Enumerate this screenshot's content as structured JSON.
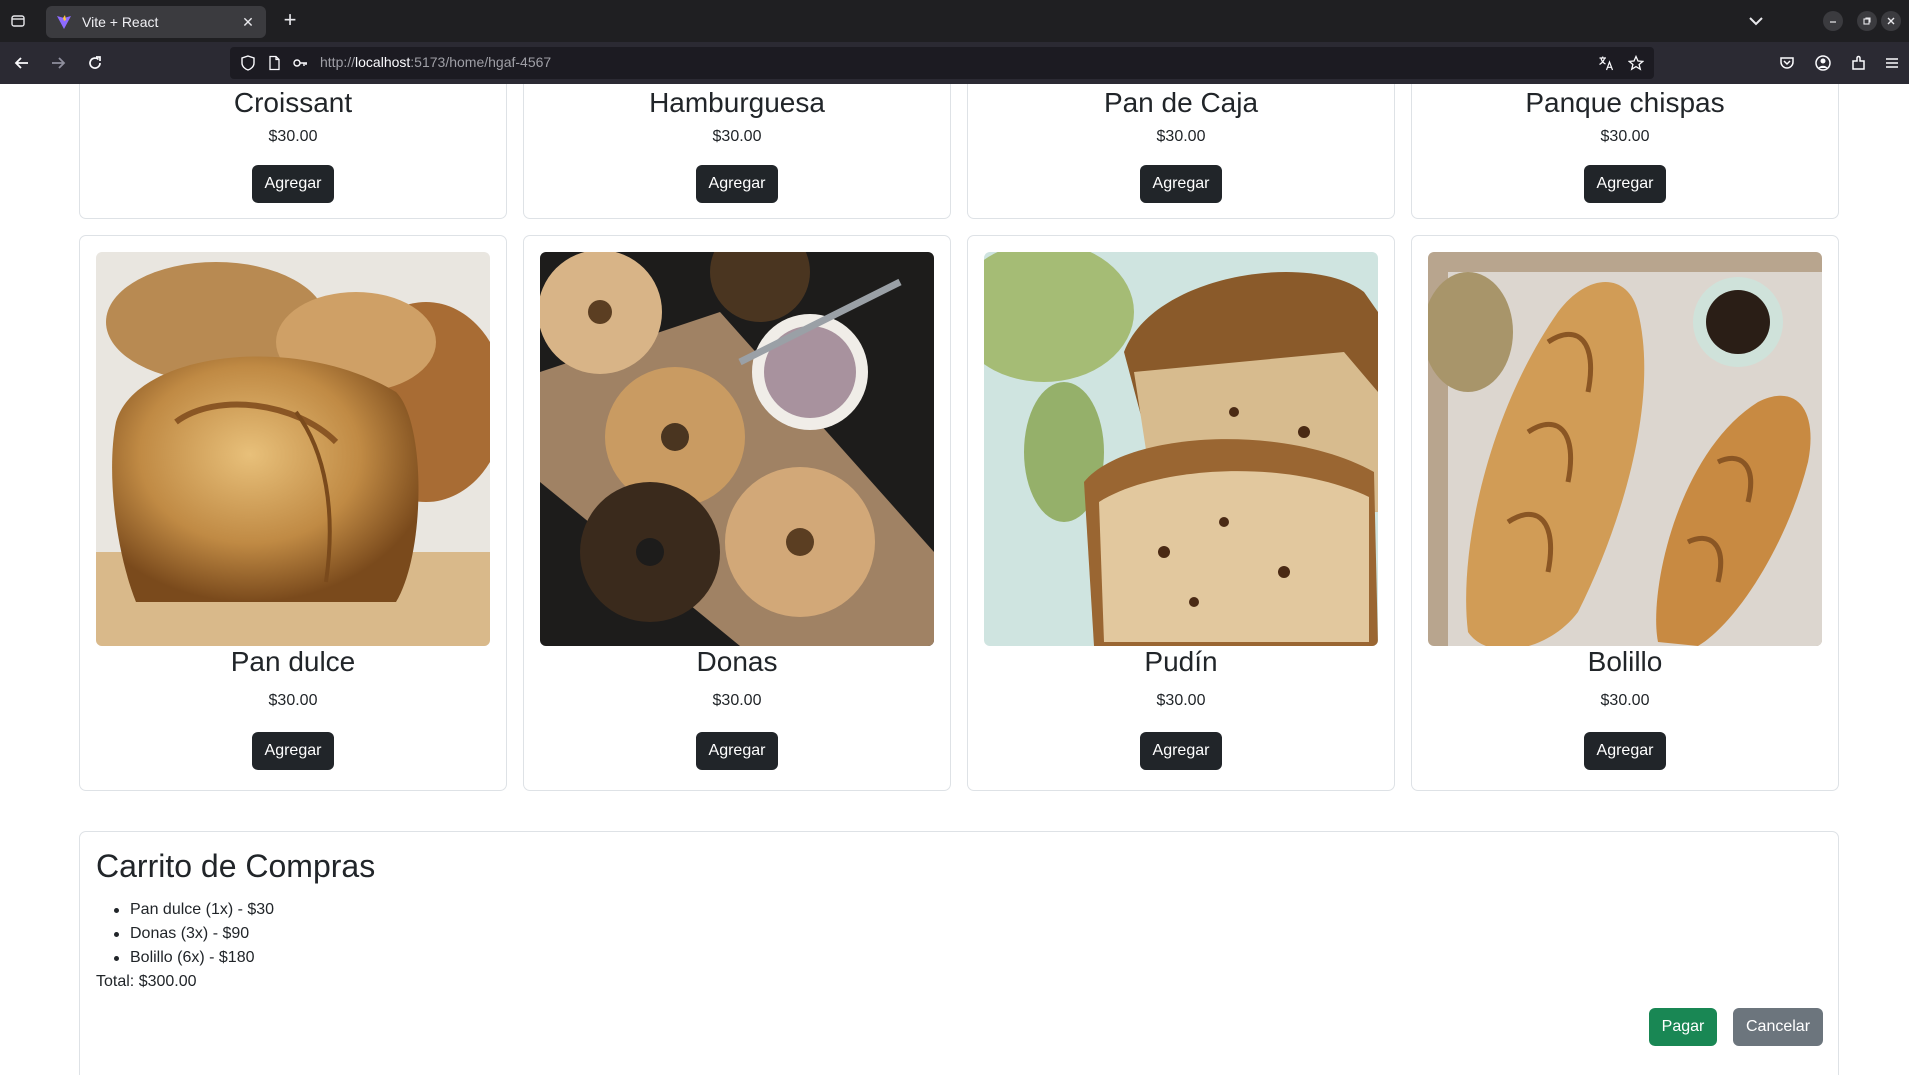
{
  "browser": {
    "tab_title": "Vite + React",
    "close_glyph": "✕",
    "newtab_glyph": "+",
    "url_scheme": "http://",
    "url_host": "localhost",
    "url_path": ":5173/home/hgaf-4567"
  },
  "products_top": [
    {
      "name": "Croissant",
      "price": "$30.00",
      "button": "Agregar"
    },
    {
      "name": "Hamburguesa",
      "price": "$30.00",
      "button": "Agregar"
    },
    {
      "name": "Pan de Caja",
      "price": "$30.00",
      "button": "Agregar"
    },
    {
      "name": "Panque chispas",
      "price": "$30.00",
      "button": "Agregar"
    }
  ],
  "products": [
    {
      "name": "Pan dulce",
      "price": "$30.00",
      "button": "Agregar",
      "image": "bread-loaf"
    },
    {
      "name": "Donas",
      "price": "$30.00",
      "button": "Agregar",
      "image": "bagels"
    },
    {
      "name": "Pudín",
      "price": "$30.00",
      "button": "Agregar",
      "image": "banana-bread"
    },
    {
      "name": "Bolillo",
      "price": "$30.00",
      "button": "Agregar",
      "image": "baguettes"
    }
  ],
  "cart": {
    "title": "Carrito de Compras",
    "items": [
      "Pan dulce (1x) - $30",
      "Donas (3x) - $90",
      "Bolillo (6x) - $180"
    ],
    "total": "Total: $300.00",
    "pay_label": "Pagar",
    "cancel_label": "Cancelar"
  },
  "colors": {
    "button_dark": "#212529",
    "button_success": "#198754",
    "button_secondary": "#6c757d",
    "card_border": "#dee2e6"
  }
}
